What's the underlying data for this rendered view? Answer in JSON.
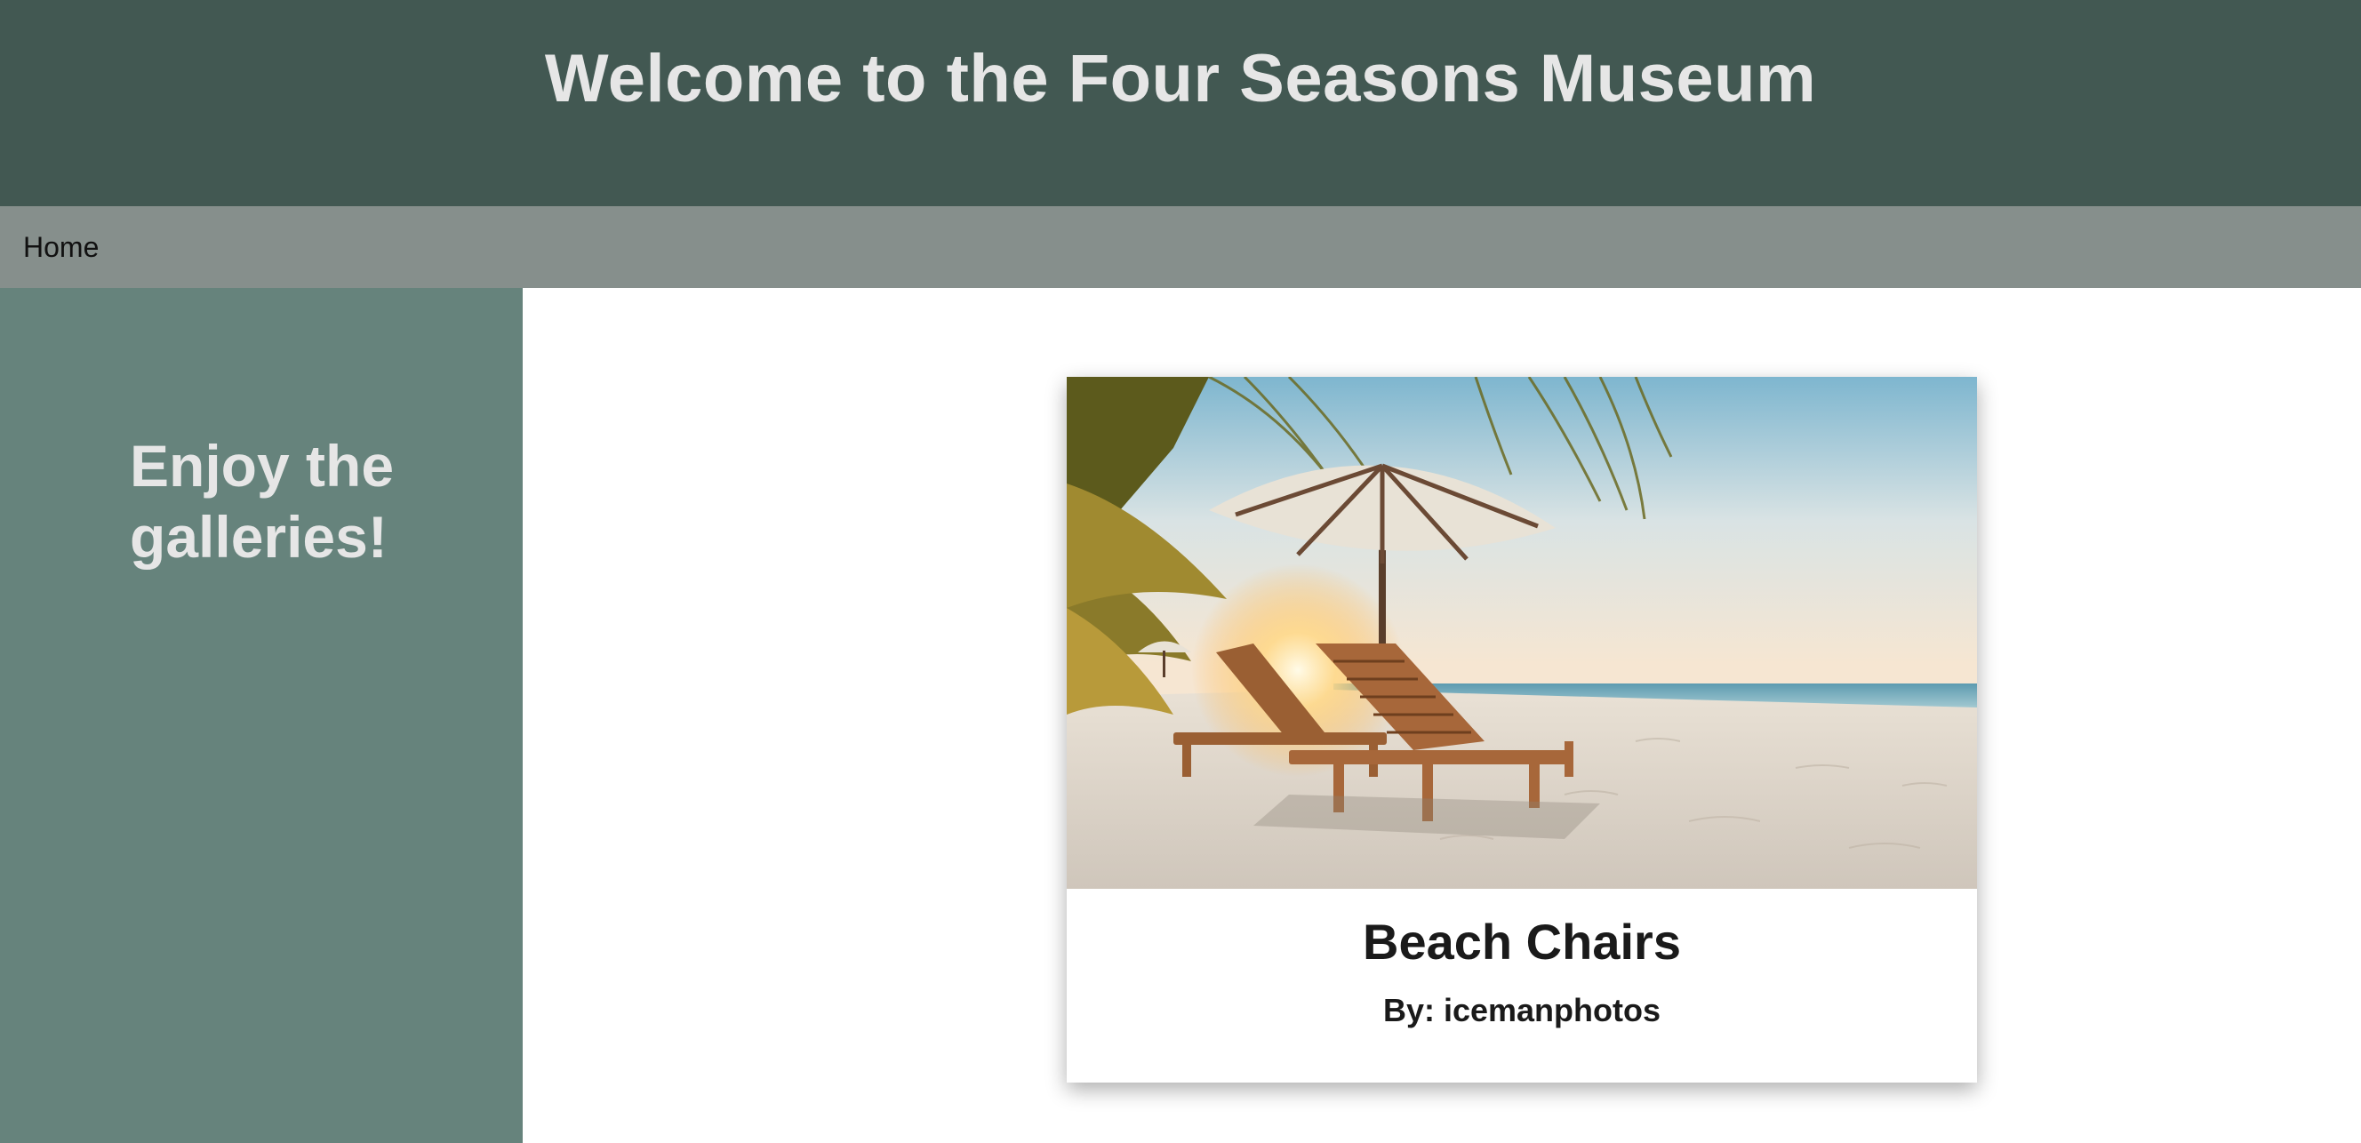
{
  "header": {
    "title": "Welcome to the Four Seasons Museum"
  },
  "nav": {
    "items": [
      {
        "label": "Home"
      }
    ]
  },
  "sidebar": {
    "heading": "Enjoy the galleries!"
  },
  "gallery": {
    "card": {
      "title": "Beach Chairs",
      "credit": "By: icemanphotos",
      "image": "beach-chairs-photo"
    }
  },
  "colors": {
    "header_bg": "#425852",
    "nav_bg": "#868f8c",
    "sidebar_bg": "#66837c",
    "heading_text": "#e6e6e6"
  }
}
